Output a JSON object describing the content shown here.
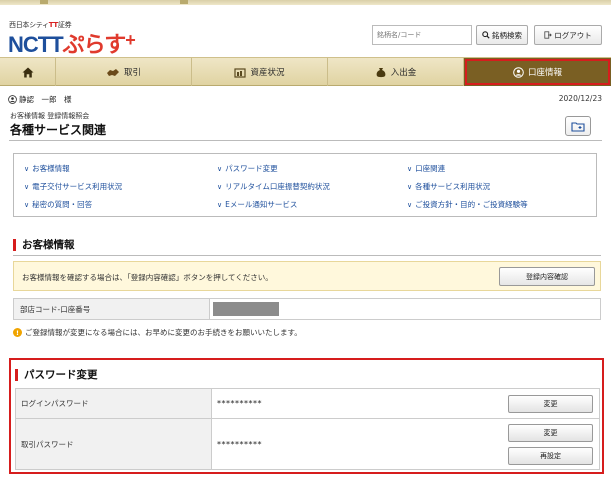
{
  "brand": {
    "sub_prefix": "西日本シティ",
    "sub_red": "TT",
    "sub_suffix": "証券",
    "main_ncttt": "NCTT",
    "main_rest": "ぷらす",
    "plus": "+"
  },
  "header": {
    "search_placeholder": "銘柄名/コード",
    "search_button": "銘柄検索",
    "logout_button": "ログアウト"
  },
  "nav": {
    "trade": "取引",
    "assets": "資産状況",
    "deposit": "入出金",
    "account": "口座情報"
  },
  "user": {
    "name": "静認　一郎　様",
    "date": "2020/12/23"
  },
  "page": {
    "breadcrumb": "お客様情報 登録情報照会",
    "title": "各種サービス関連"
  },
  "links": [
    "お客様情報",
    "パスワード変更",
    "口座関連",
    "電子交付サービス利用状況",
    "リアルタイム口座振替契約状況",
    "各種サービス利用状況",
    "秘密の質問・回答",
    "Eメール通知サービス",
    "ご投資方針・目的・ご投資経験等"
  ],
  "customer": {
    "section_title": "お客様情報",
    "notice": "お客様情報を確認する場合は、「登録内容確認」ボタンを押してください。",
    "confirm_button": "登録内容確認",
    "branch_label": "部店コード-口座番号",
    "change_note": "ご登録情報が変更になる場合には、お早めに変更のお手続きをお願いいたします。"
  },
  "password": {
    "section_title": "パスワード変更",
    "rows": [
      {
        "label": "ログインパスワード",
        "value": "**********",
        "buttons": [
          "変更"
        ]
      },
      {
        "label": "取引パスワード",
        "value": "**********",
        "buttons": [
          "変更",
          "再設定"
        ]
      }
    ]
  },
  "colors": {
    "brand_blue": "#1e4f9c",
    "accent_red": "#d61d1d",
    "nav_active": "#7a5f23",
    "nav_bg": "#e8dcb2"
  }
}
